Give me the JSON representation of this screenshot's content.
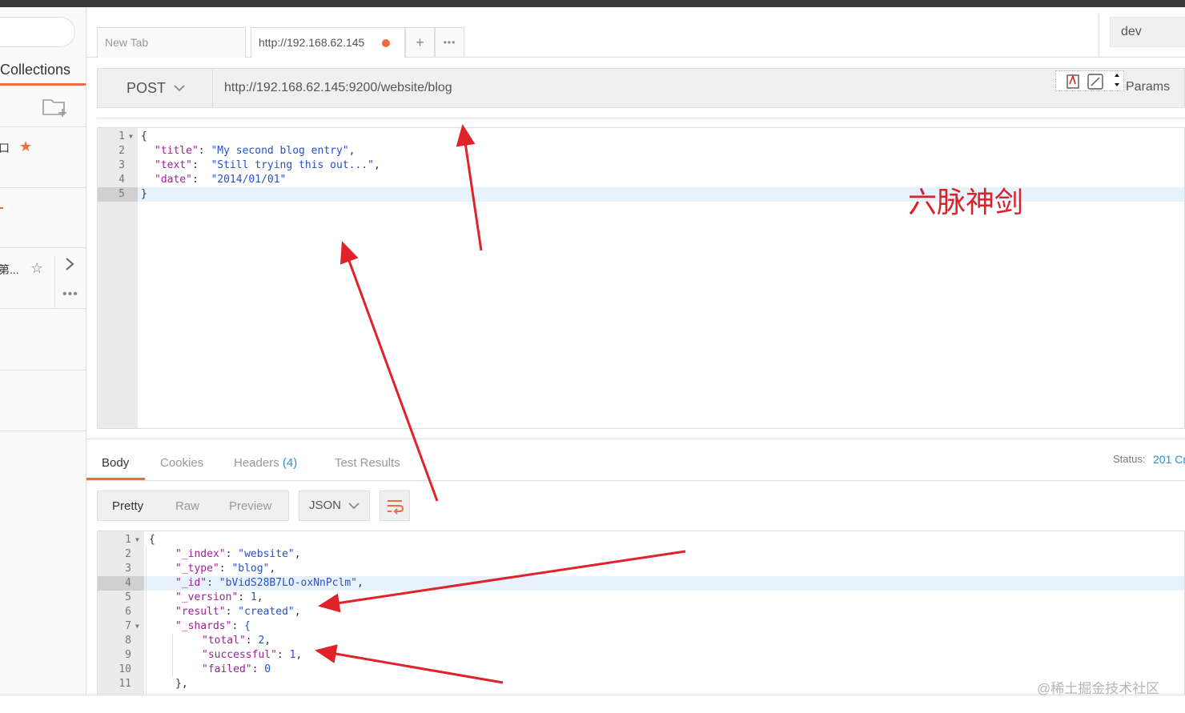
{
  "sidebar": {
    "collections_label": "Collections",
    "fragment_top": "口",
    "fragment_mid": "第...",
    "icons": [
      "new-folder-icon",
      "star-filled-icon",
      "star-outline-icon",
      "chevron-right-icon",
      "more-icon"
    ]
  },
  "tabs": {
    "items": [
      {
        "label": "New Tab"
      },
      {
        "label": "http://192.168.62.145",
        "unsaved": true
      }
    ],
    "add_label": "+",
    "more_label": "•••"
  },
  "environment": {
    "selected": "dev"
  },
  "request": {
    "method": "POST",
    "url": "http://192.168.62.145:9200/website/blog",
    "params_label": "Params",
    "body_lines": [
      {
        "n": "1",
        "text": "{",
        "fold": true
      },
      {
        "n": "2",
        "key": "\"title\"",
        "sep": ": ",
        "val": "\"My second blog entry\"",
        "end": ","
      },
      {
        "n": "3",
        "key": "\"text\"",
        "sep": ":  ",
        "val": "\"Still trying this out...\"",
        "end": ","
      },
      {
        "n": "4",
        "key": "\"date\"",
        "sep": ":  ",
        "val": "\"2014/01/01\"",
        "end": ""
      },
      {
        "n": "5",
        "text": "}",
        "highlight": true
      }
    ]
  },
  "response": {
    "tabs": [
      {
        "label": "Body",
        "active": true
      },
      {
        "label": "Cookies"
      },
      {
        "label": "Headers",
        "count": "(4)"
      },
      {
        "label": "Test Results"
      }
    ],
    "status_label": "Status:",
    "status_value": "201 Cr",
    "formats": [
      "Pretty",
      "Raw",
      "Preview"
    ],
    "active_format": "Pretty",
    "language": "JSON",
    "body_lines": [
      {
        "n": "1",
        "indent": 0,
        "text": "{",
        "fold": true
      },
      {
        "n": "2",
        "indent": 1,
        "key": "\"_index\"",
        "val": "\"website\"",
        "end": ","
      },
      {
        "n": "3",
        "indent": 1,
        "key": "\"_type\"",
        "val": "\"blog\"",
        "end": ","
      },
      {
        "n": "4",
        "indent": 1,
        "key": "\"_id\"",
        "val": "\"bVidS28B7LO-oxNnPclm\"",
        "end": ",",
        "highlight": true
      },
      {
        "n": "5",
        "indent": 1,
        "key": "\"_version\"",
        "val": "1",
        "end": ","
      },
      {
        "n": "6",
        "indent": 1,
        "key": "\"result\"",
        "val": "\"created\"",
        "end": ","
      },
      {
        "n": "7",
        "indent": 1,
        "key": "\"_shards\"",
        "val": "{",
        "end": "",
        "fold": true
      },
      {
        "n": "8",
        "indent": 2,
        "key": "\"total\"",
        "val": "2",
        "end": ","
      },
      {
        "n": "9",
        "indent": 2,
        "key": "\"successful\"",
        "val": "1",
        "end": ","
      },
      {
        "n": "10",
        "indent": 2,
        "key": "\"failed\"",
        "val": "0",
        "end": ""
      },
      {
        "n": "11",
        "indent": 1,
        "text": "},"
      }
    ]
  },
  "annotation": {
    "text": "六脉神剑",
    "color": "#d8232a"
  },
  "watermark": "@稀土掘金技术社区",
  "colors": {
    "accent": "#f26b3a",
    "link": "#2a8fd5",
    "string": "#2a4fc7",
    "key": "#9b2393"
  }
}
